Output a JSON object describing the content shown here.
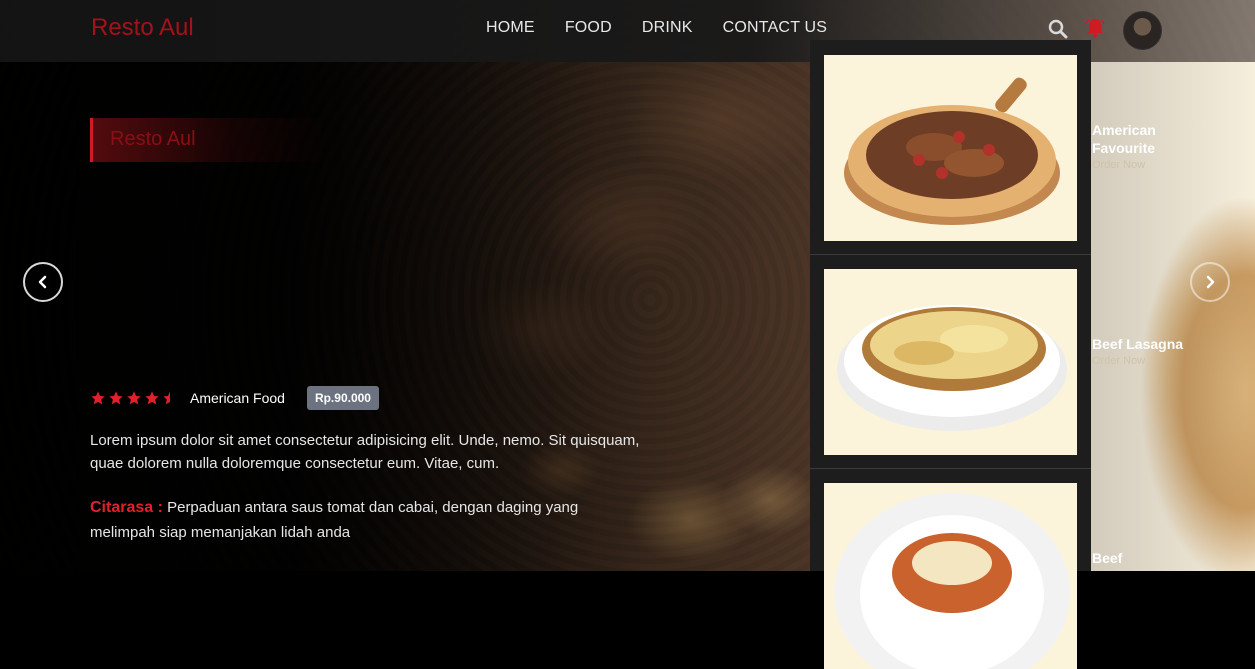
{
  "brand": "Resto Aul",
  "nav": {
    "links": [
      "HOME",
      "FOOD",
      "DRINK",
      "CONTACT US"
    ]
  },
  "hero": {
    "badge": "Resto Aul",
    "rating": 4.5,
    "category": "American Food",
    "price": "Rp.90.000",
    "description": "Lorem ipsum dolor sit amet consectetur adipisicing elit. Unde, nemo. Sit quisquam, quae dolorem nulla doloremque consectetur eum. Vitae, cum.",
    "taste_label": "Citarasa :",
    "taste_text": "Perpaduan antara saus tomat dan cabai, dengan daging yang melimpah siap memanjakan lidah anda"
  },
  "side_menu": {
    "items": [
      {
        "title": "American Favourite",
        "action": "Order Now"
      },
      {
        "title": "Beef Lasagna",
        "action": "Order Now"
      },
      {
        "title": "Beef",
        "action": ""
      }
    ]
  },
  "colors": {
    "accent": "#d01a24",
    "brand": "#a3111a",
    "price_badge": "#6c7280",
    "panel": "#1d1d1d"
  }
}
